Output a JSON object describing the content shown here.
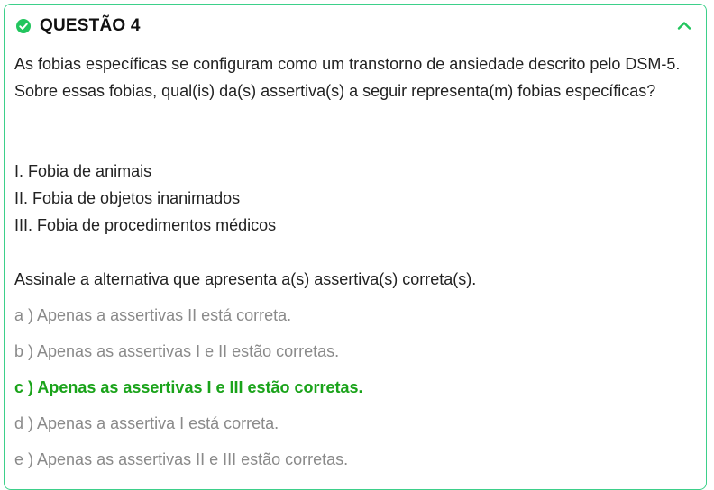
{
  "question": {
    "title": "QUESTÃO 4",
    "statement": "As fobias específicas se configuram como um transtorno de ansiedade descrito pelo DSM-5. Sobre essas fobias, qual(is) da(s) assertiva(s) a seguir representa(m) fobias específicas?",
    "items": [
      "I. Fobia de animais",
      "II. Fobia de objetos inanimados",
      "III. Fobia de procedimentos médicos"
    ],
    "instruction": "Assinale a alternativa que apresenta a(s) assertiva(s) correta(s).",
    "options": [
      "a ) Apenas a assertivas II está correta.",
      "b ) Apenas as assertivas I e II estão corretas.",
      "c ) Apenas as assertivas I e III estão corretas.",
      "d ) Apenas a assertiva I está correta.",
      "e ) Apenas as assertivas II e III estão corretas."
    ],
    "correct_option": "c"
  },
  "icons": {
    "status": "check-circle-icon",
    "toggle": "chevron-up-icon"
  },
  "colors": {
    "accent": "#22c55e",
    "border": "#3dd08a",
    "correct_text": "#1aa31a",
    "option_text": "#8a8a8a",
    "body_text": "#222222"
  }
}
